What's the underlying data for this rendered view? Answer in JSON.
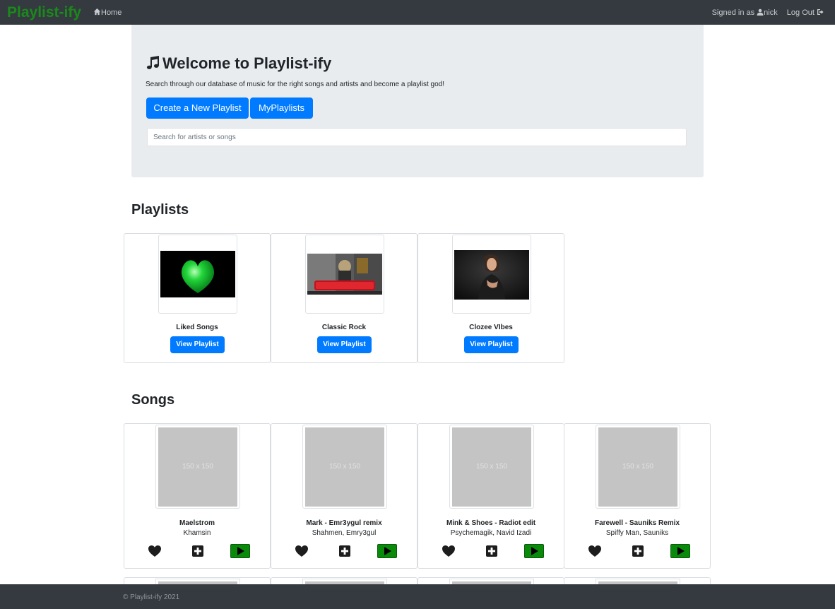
{
  "navbar": {
    "brand": "Playlist-ify",
    "home_label": "Home",
    "signed_in_prefix": "Signed in as",
    "username": "nick",
    "logout_label": "Log Out"
  },
  "hero": {
    "title": "Welcome to Playlist-ify",
    "subtitle": "Search through our database of music for the right songs and artists and become a playlist god!",
    "create_button": "Create a New Playlist",
    "my_playlists_button": "MyPlaylists",
    "search_placeholder": "Search for artists or songs"
  },
  "playlists": {
    "heading": "Playlists",
    "view_label": "View Playlist",
    "items": [
      {
        "name": "Liked Songs"
      },
      {
        "name": "Classic Rock"
      },
      {
        "name": "Clozee VIbes"
      }
    ]
  },
  "songs": {
    "heading": "Songs",
    "placeholder_text": "150 x 150",
    "items": [
      {
        "title": "Maelstrom",
        "artist": "Khamsin"
      },
      {
        "title": "Mark - Emr3ygul remix",
        "artist": "Shahmen, Emry3gul"
      },
      {
        "title": "Mink & Shoes - Radiot edit",
        "artist": "Psychemagik, Navid Izadi"
      },
      {
        "title": "Farewell - Sauniks Remix",
        "artist": "Spiffy Man, Sauniks"
      }
    ]
  },
  "footer": {
    "text": "© Playlist-ify 2021"
  },
  "colors": {
    "navbar": "#343a40",
    "brand": "#1a8a1a",
    "primary": "#007bff",
    "play": "#0a8a0a",
    "hero_bg": "#e9ecef"
  }
}
